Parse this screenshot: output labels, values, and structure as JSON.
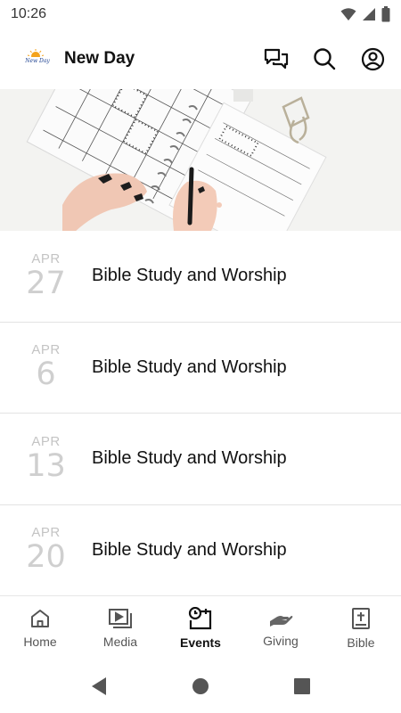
{
  "status_bar": {
    "time": "10:26",
    "icons": [
      "wifi-icon",
      "signal-icon",
      "battery-icon"
    ]
  },
  "app_bar": {
    "title": "New Day",
    "logo_text": "New Day",
    "actions": [
      "chat-icon",
      "search-icon",
      "account-icon"
    ]
  },
  "events": [
    {
      "month": "APR",
      "day": "27",
      "title": "Bible Study and Worship"
    },
    {
      "month": "APR",
      "day": "6",
      "title": "Bible Study and Worship"
    },
    {
      "month": "APR",
      "day": "13",
      "title": "Bible Study and Worship"
    },
    {
      "month": "APR",
      "day": "20",
      "title": "Bible Study and Worship"
    }
  ],
  "bottom_nav": [
    {
      "label": "Home",
      "icon": "home-icon",
      "active": false
    },
    {
      "label": "Media",
      "icon": "media-icon",
      "active": false
    },
    {
      "label": "Events",
      "icon": "events-icon",
      "active": true
    },
    {
      "label": "Giving",
      "icon": "giving-icon",
      "active": false
    },
    {
      "label": "Bible",
      "icon": "bible-icon",
      "active": false
    }
  ],
  "colors": {
    "accent": "#111111",
    "muted": "#c4c4c4",
    "divider": "#e3e3e3"
  }
}
